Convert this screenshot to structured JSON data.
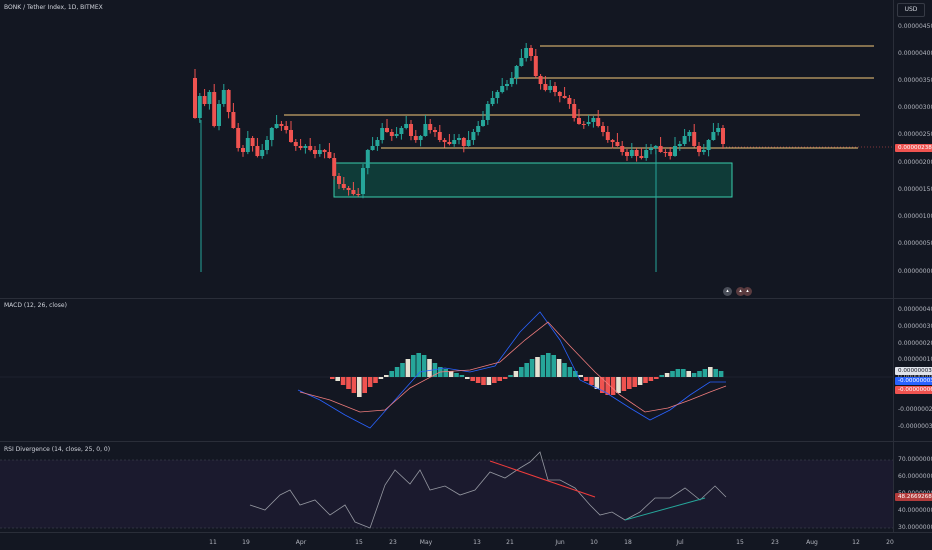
{
  "header": {
    "symbol_line": "BONK / Tether Index, 1D, BITMEX",
    "currency": "USD"
  },
  "price_panel": {
    "y_ticks": [
      "0.0000045000",
      "0.0000040000",
      "0.0000035000",
      "0.0000030000",
      "0.0000025000",
      "0.0000020000",
      "0.0000015000",
      "0.0000010000",
      "0.0000005000",
      "0.0000000000"
    ],
    "last_price_tag": "0.0000023864",
    "colors": {
      "up": "#26a69a",
      "down": "#ef5350",
      "level": "#f4c97a",
      "zone_border": "#3ad6b4",
      "zone_fill": "#0f3d3a"
    }
  },
  "macd_panel": {
    "title": "MACD (12, 26, close)",
    "y_ticks": [
      "0.0000004000",
      "0.0000003000",
      "0.0000002000",
      "0.0000001000",
      "0.0000000000",
      "-0.0000001000",
      "-0.0000002000",
      "-0.0000003000"
    ],
    "tags": [
      "0.0000000360",
      "-0.0000000323",
      "-0.0000000682"
    ]
  },
  "rsi_panel": {
    "title": "RSI Divergence (14, close, 25, 0, 0)",
    "y_ticks": [
      "70.0000000",
      "60.0000000",
      "50.0000000",
      "40.0000000",
      "30.0000000"
    ],
    "tag": "48.2669268"
  },
  "time_axis": {
    "labels": [
      "11",
      "19",
      "Apr",
      "15",
      "23",
      "May",
      "13",
      "21",
      "Jun",
      "10",
      "18",
      "Jul",
      "15",
      "23",
      "Aug",
      "12",
      "20"
    ]
  }
}
